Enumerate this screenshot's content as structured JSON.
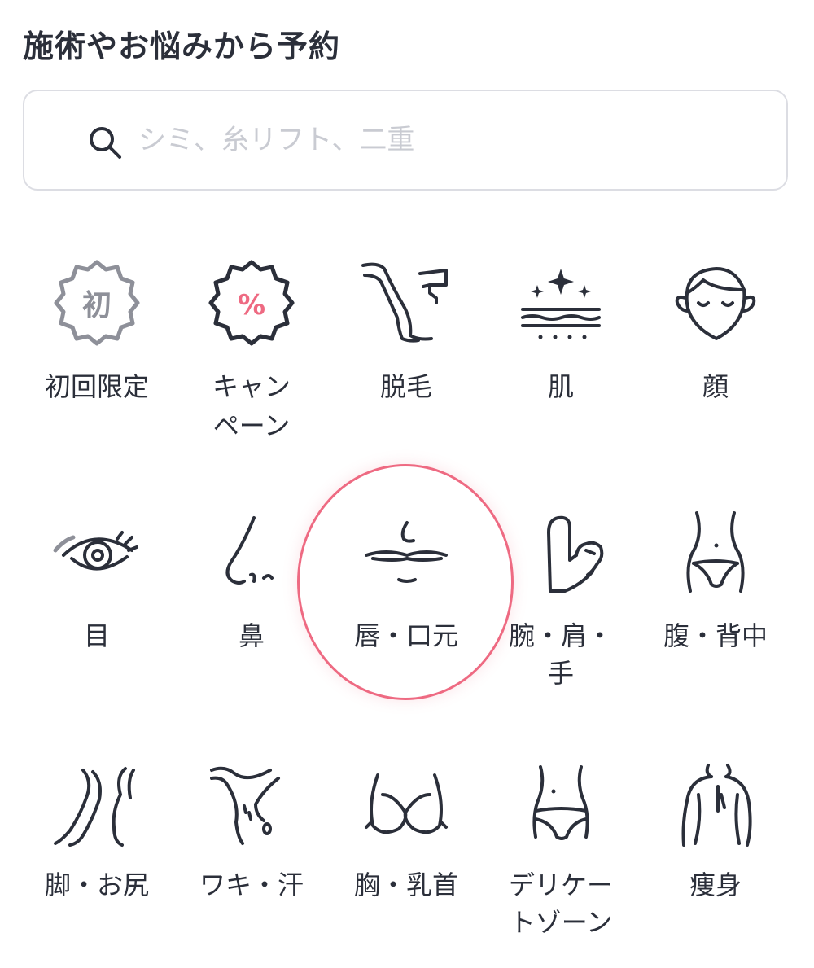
{
  "header": {
    "title": "施術やお悩みから予約"
  },
  "search": {
    "placeholder": "シミ、糸リフト、二重"
  },
  "badges": {
    "first_time": "初",
    "campaign": "%"
  },
  "colors": {
    "accent": "#ee6a82",
    "text": "#2b2f3a",
    "muted": "#8e9099",
    "border": "#dcdde3"
  },
  "categories": [
    {
      "icon": "first-time-badge-icon",
      "label_line1": "初回限定",
      "label_line2": ""
    },
    {
      "icon": "campaign-badge-icon",
      "label_line1": "キャン",
      "label_line2": "ペーン"
    },
    {
      "icon": "hair-removal-icon",
      "label_line1": "脱毛",
      "label_line2": ""
    },
    {
      "icon": "skin-icon",
      "label_line1": "肌",
      "label_line2": ""
    },
    {
      "icon": "face-icon",
      "label_line1": "顔",
      "label_line2": ""
    },
    {
      "icon": "eye-icon",
      "label_line1": "目",
      "label_line2": ""
    },
    {
      "icon": "nose-icon",
      "label_line1": "鼻",
      "label_line2": ""
    },
    {
      "icon": "lips-icon",
      "label_line1": "唇・口元",
      "label_line2": ""
    },
    {
      "icon": "arm-icon",
      "label_line1": "腕・肩・",
      "label_line2": "手"
    },
    {
      "icon": "abdomen-icon",
      "label_line1": "腹・背中",
      "label_line2": ""
    },
    {
      "icon": "legs-icon",
      "label_line1": "脚・お尻",
      "label_line2": ""
    },
    {
      "icon": "underarm-icon",
      "label_line1": "ワキ・汗",
      "label_line2": ""
    },
    {
      "icon": "chest-icon",
      "label_line1": "胸・乳首",
      "label_line2": ""
    },
    {
      "icon": "delicate-zone-icon",
      "label_line1": "デリケー",
      "label_line2": "トゾーン"
    },
    {
      "icon": "body-slimming-icon",
      "label_line1": "痩身",
      "label_line2": ""
    }
  ]
}
